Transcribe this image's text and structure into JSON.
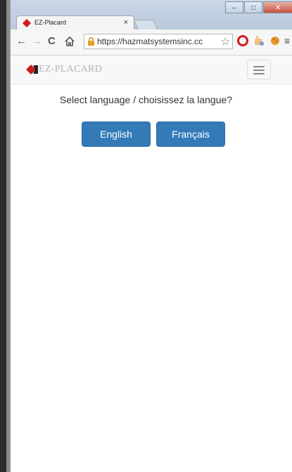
{
  "browser": {
    "tab_title": "EZ-Placard",
    "tab_close": "×",
    "url": "https://hazmatsystemsinc.cc",
    "window_controls": {
      "minimize": "–",
      "maximize": "□",
      "close": "✕"
    }
  },
  "navbar": {
    "brand_text": "EZ-PLACARD"
  },
  "main": {
    "prompt": "Select language / choisissez la langue?",
    "buttons": {
      "english": "English",
      "french": "Français"
    }
  },
  "colors": {
    "primary": "#337ab7",
    "logo_red": "#cc1b1b"
  }
}
